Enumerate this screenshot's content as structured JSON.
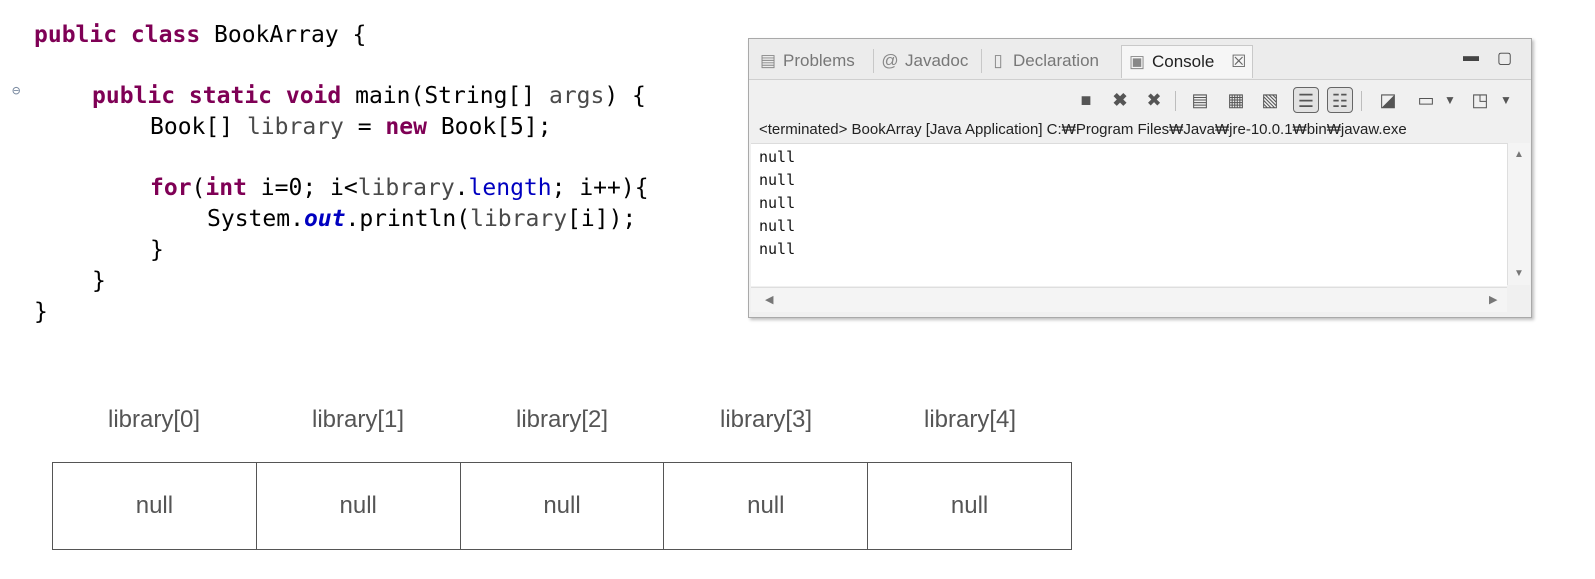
{
  "code": {
    "lines": [
      [
        "public class BookArray {"
      ],
      [
        "public static void main(String[] args) {"
      ],
      [
        "Book[] library = new Book[5];"
      ],
      [
        "for(int i=0; i<library.length; i++){"
      ],
      [
        "System.out.println(library[i]);"
      ],
      [
        "}"
      ],
      [
        "}"
      ],
      [
        "}"
      ]
    ],
    "tokens": {
      "l0": {
        "kw": "public class",
        "rest": " BookArray {"
      },
      "l1": {
        "kw": "public static void",
        "rest": " main(String[] ",
        "var": "args",
        "tail": ") {"
      },
      "l2": {
        "a": "Book[] ",
        "var": "library",
        "b": " = ",
        "kw": "new",
        "c": " Book[5];"
      },
      "l3": {
        "kw1": "for",
        "a": "(",
        "kw2": "int",
        "b": " i=0; i<",
        "var": "library",
        "c": ".",
        "fld": "length",
        "d": "; i++){"
      },
      "l4": {
        "a": "System.",
        "ital": "out",
        "b": ".println(",
        "var": "library",
        "c": "[i]);"
      },
      "l5": "}",
      "l6": "}",
      "l7": "}"
    }
  },
  "console": {
    "tabs": [
      {
        "label": "Problems",
        "icon": "problems-icon"
      },
      {
        "label": "Javadoc",
        "icon": "at-icon"
      },
      {
        "label": "Declaration",
        "icon": "declaration-icon"
      },
      {
        "label": "Console",
        "icon": "console-icon",
        "active": true
      }
    ],
    "close_glyph": "☒",
    "status": "<terminated> BookArray [Java Application] C:₩Program Files₩Java₩jre-10.0.1₩bin₩javaw.exe",
    "output": [
      "null",
      "null",
      "null",
      "null",
      "null"
    ]
  },
  "diagram": {
    "labels": [
      "library[0]",
      "library[1]",
      "library[2]",
      "library[3]",
      "library[4]"
    ],
    "cells": [
      "null",
      "null",
      "null",
      "null",
      "null"
    ]
  }
}
